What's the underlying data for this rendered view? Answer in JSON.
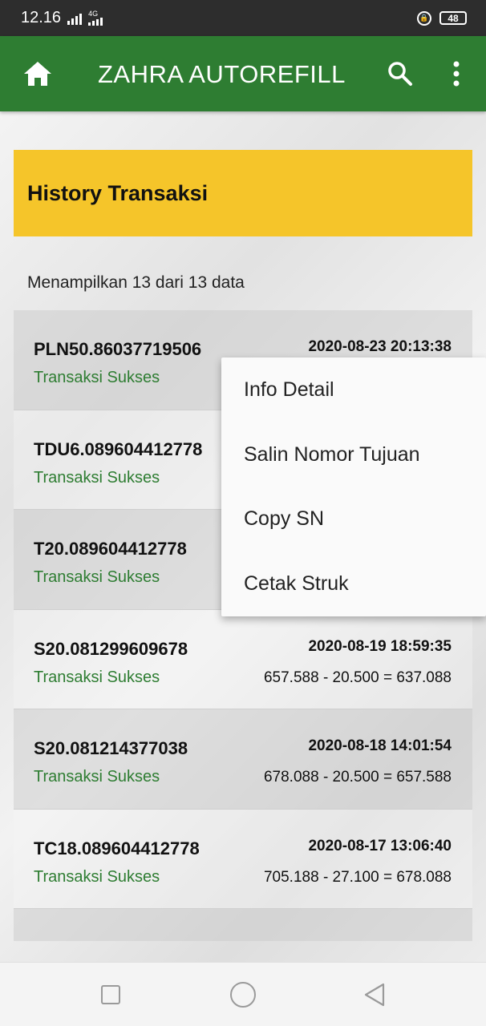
{
  "status_bar": {
    "time": "12.16",
    "network": "4G",
    "battery": "48"
  },
  "app_bar": {
    "title": "ZAHRA AUTOREFILL",
    "icons": [
      "home-icon",
      "search-icon",
      "more-vert-icon"
    ],
    "color": "#2e7d32"
  },
  "page": {
    "header_title": "History Transaksi",
    "header_color": "#f5c52a",
    "count_text": "Menampilkan 13 dari 13 data"
  },
  "transactions": [
    {
      "product": "PLN50.86037719506",
      "status": "Transaksi Sukses",
      "date": "2020-08-23 20:13:38",
      "saldo": ""
    },
    {
      "product": "TDU6.089604412778",
      "status": "Transaksi Sukses",
      "date": "",
      "saldo": ""
    },
    {
      "product": "T20.089604412778",
      "status": "Transaksi Sukses",
      "date": "",
      "saldo": ""
    },
    {
      "product": "S20.081299609678",
      "status": "Transaksi Sukses",
      "date": "2020-08-19 18:59:35",
      "saldo": "657.588 - 20.500 = 637.088"
    },
    {
      "product": "S20.081214377038",
      "status": "Transaksi Sukses",
      "date": "2020-08-18 14:01:54",
      "saldo": "678.088 - 20.500 = 657.588"
    },
    {
      "product": "TC18.089604412778",
      "status": "Transaksi Sukses",
      "date": "2020-08-17 13:06:40",
      "saldo": "705.188 - 27.100 = 678.088"
    }
  ],
  "popup_menu": {
    "items": [
      "Info Detail",
      "Salin Nomor Tujuan",
      "Copy SN",
      "Cetak Struk"
    ]
  },
  "nav_bar": {
    "icons": [
      "recent-apps-icon",
      "home-circle-icon",
      "back-icon"
    ]
  }
}
